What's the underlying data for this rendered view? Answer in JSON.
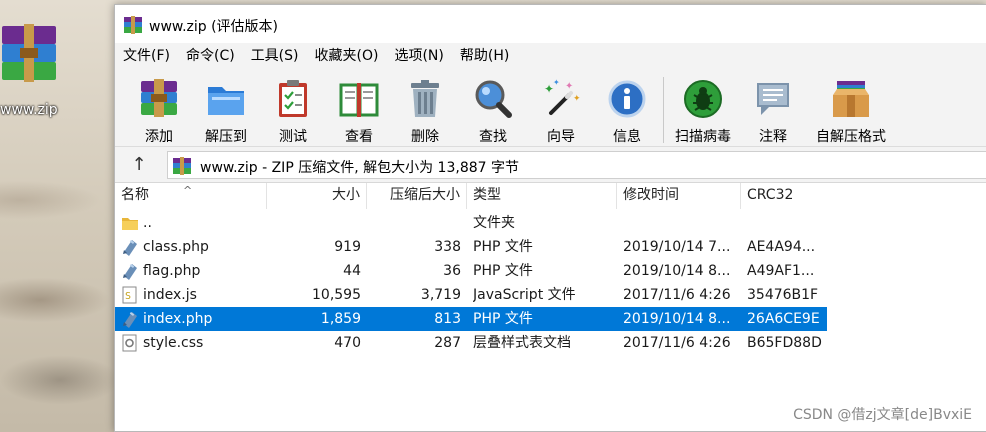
{
  "desktop": {
    "icon_label": "www.zip"
  },
  "window": {
    "title": "www.zip (评估版本)"
  },
  "menu": [
    "文件(F)",
    "命令(C)",
    "工具(S)",
    "收藏夹(O)",
    "选项(N)",
    "帮助(H)"
  ],
  "toolbar": {
    "add": "添加",
    "extract": "解压到",
    "test": "测试",
    "view": "查看",
    "delete": "删除",
    "find": "查找",
    "wizard": "向导",
    "info": "信息",
    "scan": "扫描病毒",
    "comment": "注释",
    "sfx": "自解压格式"
  },
  "address": {
    "text": "www.zip - ZIP 压缩文件, 解包大小为 13,887 字节"
  },
  "columns": {
    "name": "名称",
    "size": "大小",
    "packed": "压缩后大小",
    "type": "类型",
    "modified": "修改时间",
    "crc": "CRC32"
  },
  "rows": [
    {
      "name": "..",
      "size": "",
      "packed": "",
      "type": "文件夹",
      "modified": "",
      "crc": "",
      "icon": "folder-icon"
    },
    {
      "name": "class.php",
      "size": "919",
      "packed": "338",
      "type": "PHP 文件",
      "modified": "2019/10/14 7...",
      "crc": "AE4A94...",
      "icon": "php-file-icon"
    },
    {
      "name": "flag.php",
      "size": "44",
      "packed": "36",
      "type": "PHP 文件",
      "modified": "2019/10/14 8...",
      "crc": "A49AF1...",
      "icon": "php-file-icon"
    },
    {
      "name": "index.js",
      "size": "10,595",
      "packed": "3,719",
      "type": "JavaScript 文件",
      "modified": "2017/11/6 4:26",
      "crc": "35476B1F",
      "icon": "js-file-icon"
    },
    {
      "name": "index.php",
      "size": "1,859",
      "packed": "813",
      "type": "PHP 文件",
      "modified": "2019/10/14 8...",
      "crc": "26A6CE9E",
      "icon": "php-file-icon",
      "selected": true
    },
    {
      "name": "style.css",
      "size": "470",
      "packed": "287",
      "type": "层叠样式表文档",
      "modified": "2017/11/6 4:26",
      "crc": "B65FD88D",
      "icon": "css-file-icon"
    }
  ],
  "watermark": "CSDN @借zj文章[de]BvxiE",
  "colors": {
    "selection": "#0078d7"
  }
}
